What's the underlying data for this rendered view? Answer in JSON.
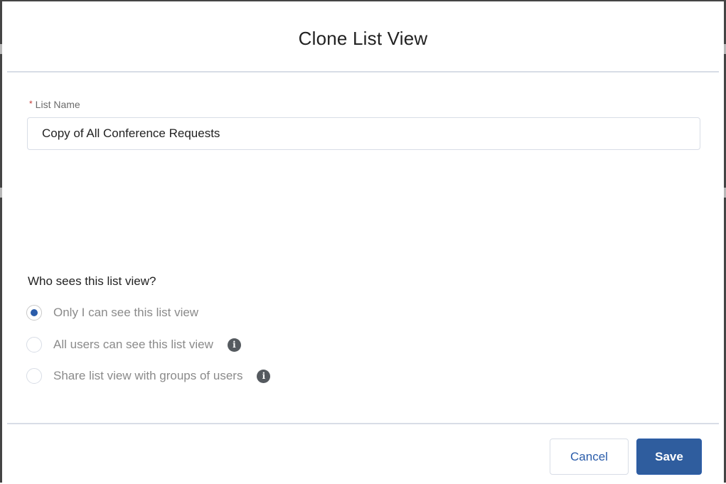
{
  "modal": {
    "title": "Clone List View"
  },
  "list_name": {
    "required_marker": "*",
    "label": "List Name",
    "value": "Copy of All Conference Requests"
  },
  "visibility": {
    "title": "Who sees this list view?",
    "options": [
      {
        "label": "Only I can see this list view",
        "selected": true,
        "info_icon": false
      },
      {
        "label": "All users can see this list view",
        "selected": false,
        "info_icon": true
      },
      {
        "label": "Share list view with groups of users",
        "selected": false,
        "info_icon": true
      }
    ],
    "info_icon_glyph": "i"
  },
  "footer": {
    "cancel_label": "Cancel",
    "save_label": "Save"
  },
  "colors": {
    "brand_blue": "#2f5d9e",
    "required_red": "#c23934",
    "info_icon_gray": "#555a5f"
  },
  "icons": {
    "info": "info-icon",
    "radio": "radio-icon"
  }
}
